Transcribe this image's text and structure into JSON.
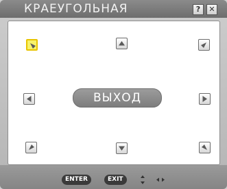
{
  "window": {
    "title": "КРАЕУГОЛЬНАЯ",
    "help_label": "?",
    "close_label": "✕"
  },
  "main": {
    "exit_label": "ВЫХОД",
    "corner_keys": [
      {
        "name": "top-left",
        "direction": "down-right",
        "selected": true
      },
      {
        "name": "top-center",
        "direction": "up"
      },
      {
        "name": "top-right",
        "direction": "down-left"
      },
      {
        "name": "middle-left",
        "direction": "left"
      },
      {
        "name": "middle-right",
        "direction": "right"
      },
      {
        "name": "bottom-left",
        "direction": "up-right"
      },
      {
        "name": "bottom-center",
        "direction": "down"
      },
      {
        "name": "bottom-right",
        "direction": "up-left"
      }
    ]
  },
  "footer": {
    "enter_label": "ENTER",
    "exit_label": "EXIT",
    "updown_icon": "up-down-arrows-icon",
    "leftright_icon": "left-right-arrows-icon"
  },
  "colors": {
    "selection": "#f7f26a",
    "selection_border": "#e8c400"
  }
}
